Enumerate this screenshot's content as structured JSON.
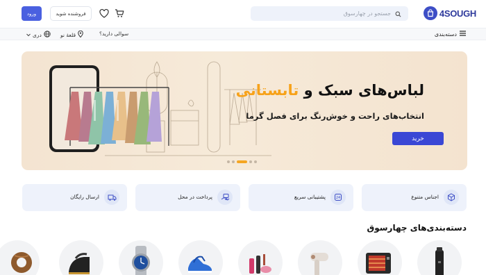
{
  "header": {
    "logo_text": "4SOUGH",
    "search_placeholder": "جستجو در چهارسوق",
    "seller_label": "فروشنده شوید",
    "login_label": "ورود"
  },
  "nav": {
    "categories_label": "دسته‌بندی",
    "question_label": "سوالی دارید؟",
    "location_label": "قلعهٔ نو",
    "language_label": "دری"
  },
  "banner": {
    "title_main": "لباس‌های سبک و ",
    "title_highlight": "تابستانی",
    "subtitle": "انتخاب‌های راحت و خوش‌رنگ برای فصل گرما",
    "button_label": "خرید",
    "slide_count": 5,
    "active_slide": 3
  },
  "features": [
    {
      "label": "اجناس متنوع",
      "icon": "box-icon"
    },
    {
      "label": "پشتیبانی سریع",
      "icon": "support-24-icon"
    },
    {
      "label": "پرداخت در محل",
      "icon": "cash-hand-icon"
    },
    {
      "label": "ارسال رایگان",
      "icon": "truck-icon"
    }
  ],
  "categories": {
    "title": "دسته‌بندی‌های چهارسوق",
    "items": [
      {
        "icon": "thermos-icon"
      },
      {
        "icon": "heater-icon"
      },
      {
        "icon": "hair-dryer-icon"
      },
      {
        "icon": "cosmetics-icon"
      },
      {
        "icon": "shoes-icon"
      },
      {
        "icon": "watch-icon"
      },
      {
        "icon": "iron-icon"
      },
      {
        "icon": "bread-icon"
      }
    ]
  },
  "colors": {
    "brand": "#3d4ec6",
    "accent": "#f5a623",
    "button": "#4a60e0"
  }
}
